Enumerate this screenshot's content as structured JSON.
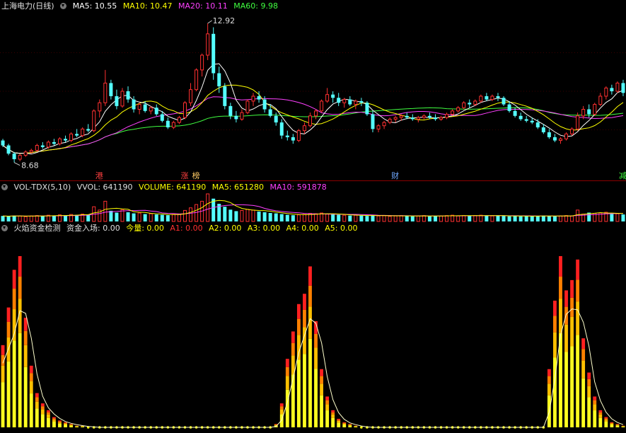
{
  "main_panel": {
    "title": "上海电力(日线)",
    "ma5": "MA5: 10.55",
    "ma10": "MA10: 10.47",
    "ma20": "MA20: 10.11",
    "ma60": "MA60: 9.98",
    "high_label": "12.92",
    "low_label": "8.68",
    "markers": [
      {
        "text": "港",
        "color": "#ff4040"
      },
      {
        "text": "涨",
        "color": "#ff4040"
      },
      {
        "text": "榜",
        "color": "#ffcc66"
      },
      {
        "text": "财",
        "color": "#6fa8ff"
      },
      {
        "text": "减",
        "color": "#40ff40"
      }
    ],
    "colors": {
      "ma5": "#ffffff",
      "ma10": "#ffff00",
      "ma20": "#ff40ff",
      "ma60": "#40ff40",
      "up": "#ff3030",
      "down": "#54ffff"
    }
  },
  "volume_panel": {
    "title": "VOL-TDX(5,10)",
    "vvol": "VVOL: 641190",
    "volume": "VOLUME: 641190",
    "ma5": "MA5: 651280",
    "ma10": "MA10: 591878"
  },
  "flame_panel": {
    "title": "火焰资金检测",
    "capital_in": "资金入场: 0.00",
    "today": "今量: 0.00",
    "a1": "A1: 0.00",
    "a2": "A2: 0.00",
    "a3": "A3: 0.00",
    "a4": "A4: 0.00",
    "a5": "A5: 0.00"
  },
  "chart_data": {
    "type": "candlestick",
    "candles": [
      [
        9.35,
        9.4,
        9.15,
        9.2
      ],
      [
        9.2,
        9.25,
        8.9,
        8.95
      ],
      [
        8.95,
        9.0,
        8.68,
        8.78
      ],
      [
        8.78,
        8.95,
        8.72,
        8.9
      ],
      [
        8.9,
        9.05,
        8.85,
        9.0
      ],
      [
        9.0,
        9.1,
        8.95,
        9.05
      ],
      [
        9.05,
        9.25,
        9.0,
        9.2
      ],
      [
        9.2,
        9.3,
        9.1,
        9.15
      ],
      [
        9.15,
        9.35,
        9.1,
        9.3
      ],
      [
        9.3,
        9.4,
        9.2,
        9.25
      ],
      [
        9.25,
        9.45,
        9.2,
        9.4
      ],
      [
        9.4,
        9.5,
        9.3,
        9.35
      ],
      [
        9.35,
        9.6,
        9.3,
        9.55
      ],
      [
        9.55,
        9.7,
        9.45,
        9.5
      ],
      [
        9.5,
        9.75,
        9.45,
        9.7
      ],
      [
        9.7,
        9.85,
        9.6,
        9.65
      ],
      [
        9.65,
        10.3,
        9.6,
        10.25
      ],
      [
        10.25,
        10.6,
        10.05,
        10.5
      ],
      [
        10.5,
        11.5,
        10.4,
        11.1
      ],
      [
        11.1,
        11.2,
        10.6,
        10.7
      ],
      [
        10.7,
        10.9,
        10.3,
        10.4
      ],
      [
        10.4,
        10.95,
        10.35,
        10.85
      ],
      [
        10.85,
        11.0,
        10.5,
        10.6
      ],
      [
        10.6,
        10.7,
        10.2,
        10.3
      ],
      [
        10.3,
        10.5,
        10.15,
        10.45
      ],
      [
        10.45,
        10.55,
        10.2,
        10.25
      ],
      [
        10.25,
        10.4,
        10.15,
        10.35
      ],
      [
        10.35,
        10.45,
        10.1,
        10.15
      ],
      [
        10.15,
        10.25,
        9.9,
        9.95
      ],
      [
        9.95,
        10.05,
        9.7,
        9.75
      ],
      [
        9.75,
        9.95,
        9.7,
        9.9
      ],
      [
        9.9,
        10.1,
        9.85,
        10.05
      ],
      [
        10.05,
        10.55,
        10.0,
        10.5
      ],
      [
        10.5,
        11.1,
        10.4,
        10.9
      ],
      [
        10.9,
        11.55,
        10.85,
        11.5
      ],
      [
        11.5,
        12.0,
        11.3,
        11.95
      ],
      [
        11.95,
        12.92,
        11.8,
        12.6
      ],
      [
        12.6,
        12.8,
        11.2,
        11.4
      ],
      [
        11.4,
        11.6,
        10.8,
        11.0
      ],
      [
        11.0,
        11.1,
        10.3,
        10.4
      ],
      [
        10.4,
        10.5,
        10.0,
        10.1
      ],
      [
        10.1,
        10.25,
        9.9,
        10.0
      ],
      [
        10.0,
        10.3,
        9.95,
        10.2
      ],
      [
        10.2,
        10.6,
        10.15,
        10.55
      ],
      [
        10.55,
        10.8,
        10.4,
        10.7
      ],
      [
        10.7,
        10.85,
        10.5,
        10.6
      ],
      [
        10.6,
        10.7,
        10.2,
        10.3
      ],
      [
        10.3,
        10.45,
        10.05,
        10.1
      ],
      [
        10.1,
        10.2,
        9.8,
        9.9
      ],
      [
        9.9,
        10.0,
        9.4,
        9.5
      ],
      [
        9.5,
        9.65,
        9.35,
        9.45
      ],
      [
        9.45,
        9.55,
        9.25,
        9.35
      ],
      [
        9.35,
        9.7,
        9.3,
        9.65
      ],
      [
        9.65,
        9.9,
        9.55,
        9.8
      ],
      [
        9.8,
        10.2,
        9.75,
        10.1
      ],
      [
        10.1,
        10.3,
        10.0,
        10.25
      ],
      [
        10.25,
        10.6,
        10.2,
        10.55
      ],
      [
        10.55,
        10.95,
        10.5,
        10.75
      ],
      [
        10.75,
        10.85,
        10.5,
        10.65
      ],
      [
        10.65,
        10.8,
        10.4,
        10.5
      ],
      [
        10.5,
        10.65,
        10.35,
        10.6
      ],
      [
        10.6,
        10.7,
        10.4,
        10.45
      ],
      [
        10.45,
        10.6,
        10.3,
        10.55
      ],
      [
        10.55,
        10.65,
        10.4,
        10.5
      ],
      [
        10.5,
        10.55,
        10.1,
        10.15
      ],
      [
        10.15,
        10.25,
        9.6,
        9.7
      ],
      [
        9.7,
        9.85,
        9.6,
        9.8
      ],
      [
        9.8,
        9.95,
        9.7,
        9.9
      ],
      [
        9.9,
        10.05,
        9.85,
        10.0
      ],
      [
        10.0,
        10.1,
        9.9,
        10.05
      ],
      [
        10.05,
        10.15,
        9.95,
        10.1
      ],
      [
        10.1,
        10.2,
        10.0,
        10.05
      ],
      [
        10.05,
        10.15,
        9.95,
        10.0
      ],
      [
        10.0,
        10.1,
        9.9,
        10.05
      ],
      [
        10.05,
        10.15,
        10.0,
        10.1
      ],
      [
        10.1,
        10.2,
        10.0,
        10.05
      ],
      [
        10.05,
        10.15,
        9.95,
        10.0
      ],
      [
        10.0,
        10.1,
        9.95,
        10.05
      ],
      [
        10.05,
        10.2,
        10.0,
        10.15
      ],
      [
        10.15,
        10.3,
        10.1,
        10.25
      ],
      [
        10.25,
        10.4,
        10.2,
        10.35
      ],
      [
        10.35,
        10.55,
        10.3,
        10.5
      ],
      [
        10.5,
        10.6,
        10.35,
        10.45
      ],
      [
        10.45,
        10.6,
        10.4,
        10.55
      ],
      [
        10.55,
        10.75,
        10.5,
        10.7
      ],
      [
        10.7,
        10.8,
        10.55,
        10.6
      ],
      [
        10.6,
        10.75,
        10.55,
        10.7
      ],
      [
        10.7,
        10.8,
        10.55,
        10.65
      ],
      [
        10.65,
        10.7,
        10.4,
        10.45
      ],
      [
        10.45,
        10.55,
        10.2,
        10.25
      ],
      [
        10.25,
        10.35,
        10.05,
        10.1
      ],
      [
        10.1,
        10.2,
        9.95,
        10.0
      ],
      [
        10.0,
        10.1,
        9.9,
        9.95
      ],
      [
        9.95,
        10.05,
        9.85,
        9.9
      ],
      [
        9.9,
        10.0,
        9.7,
        9.75
      ],
      [
        9.75,
        9.85,
        9.55,
        9.6
      ],
      [
        9.6,
        9.7,
        9.4,
        9.45
      ],
      [
        9.45,
        9.55,
        9.3,
        9.35
      ],
      [
        9.35,
        9.45,
        9.25,
        9.4
      ],
      [
        9.4,
        9.6,
        9.35,
        9.55
      ],
      [
        9.55,
        9.75,
        9.5,
        9.7
      ],
      [
        9.7,
        10.2,
        9.65,
        10.1
      ],
      [
        10.1,
        10.4,
        10.0,
        10.3
      ],
      [
        10.3,
        10.45,
        10.05,
        10.15
      ],
      [
        10.15,
        10.5,
        10.1,
        10.45
      ],
      [
        10.45,
        10.8,
        10.4,
        10.7
      ],
      [
        10.7,
        11.0,
        10.6,
        10.95
      ],
      [
        10.95,
        11.05,
        10.75,
        10.85
      ],
      [
        10.85,
        11.15,
        10.8,
        11.1
      ],
      [
        11.1,
        11.2,
        10.7,
        10.8
      ]
    ],
    "volume": [
      30,
      28,
      32,
      30,
      26,
      30,
      32,
      30,
      34,
      30,
      36,
      32,
      38,
      36,
      40,
      38,
      80,
      62,
      110,
      58,
      48,
      64,
      50,
      44,
      46,
      40,
      42,
      38,
      36,
      34,
      38,
      40,
      60,
      74,
      92,
      110,
      150,
      124,
      96,
      80,
      64,
      56,
      60,
      66,
      62,
      54,
      50,
      46,
      44,
      40,
      36,
      34,
      36,
      38,
      44,
      42,
      46,
      40,
      38,
      36,
      34,
      32,
      34,
      32,
      30,
      34,
      30,
      32,
      28,
      30,
      32,
      30,
      28,
      30,
      32,
      28,
      30,
      30,
      32,
      34,
      30,
      32,
      30,
      32,
      34,
      32,
      30,
      32,
      30,
      28,
      30,
      28,
      30,
      28,
      30,
      32,
      30,
      28,
      30,
      32,
      30,
      62,
      40,
      48,
      44,
      46,
      50,
      40,
      42,
      38
    ],
    "flame": [
      48,
      70,
      92,
      100,
      64,
      36,
      20,
      14,
      10,
      6,
      4,
      3,
      2,
      1,
      1,
      0,
      0,
      0,
      0,
      0,
      0,
      0,
      0,
      0,
      0,
      0,
      0,
      0,
      0,
      0,
      0,
      0,
      0,
      0,
      0,
      0,
      0,
      0,
      0,
      0,
      0,
      0,
      0,
      0,
      0,
      0,
      0,
      0,
      2,
      14,
      40,
      56,
      72,
      78,
      94,
      62,
      34,
      18,
      10,
      5,
      3,
      2,
      1,
      0,
      0,
      0,
      0,
      0,
      0,
      0,
      0,
      0,
      0,
      0,
      0,
      0,
      0,
      0,
      0,
      0,
      0,
      0,
      0,
      0,
      0,
      0,
      0,
      0,
      0,
      0,
      0,
      0,
      0,
      0,
      0,
      0,
      34,
      74,
      100,
      80,
      86,
      98,
      52,
      32,
      18,
      10,
      6,
      3,
      2,
      1
    ],
    "ylim": [
      8.5,
      13.2
    ]
  }
}
